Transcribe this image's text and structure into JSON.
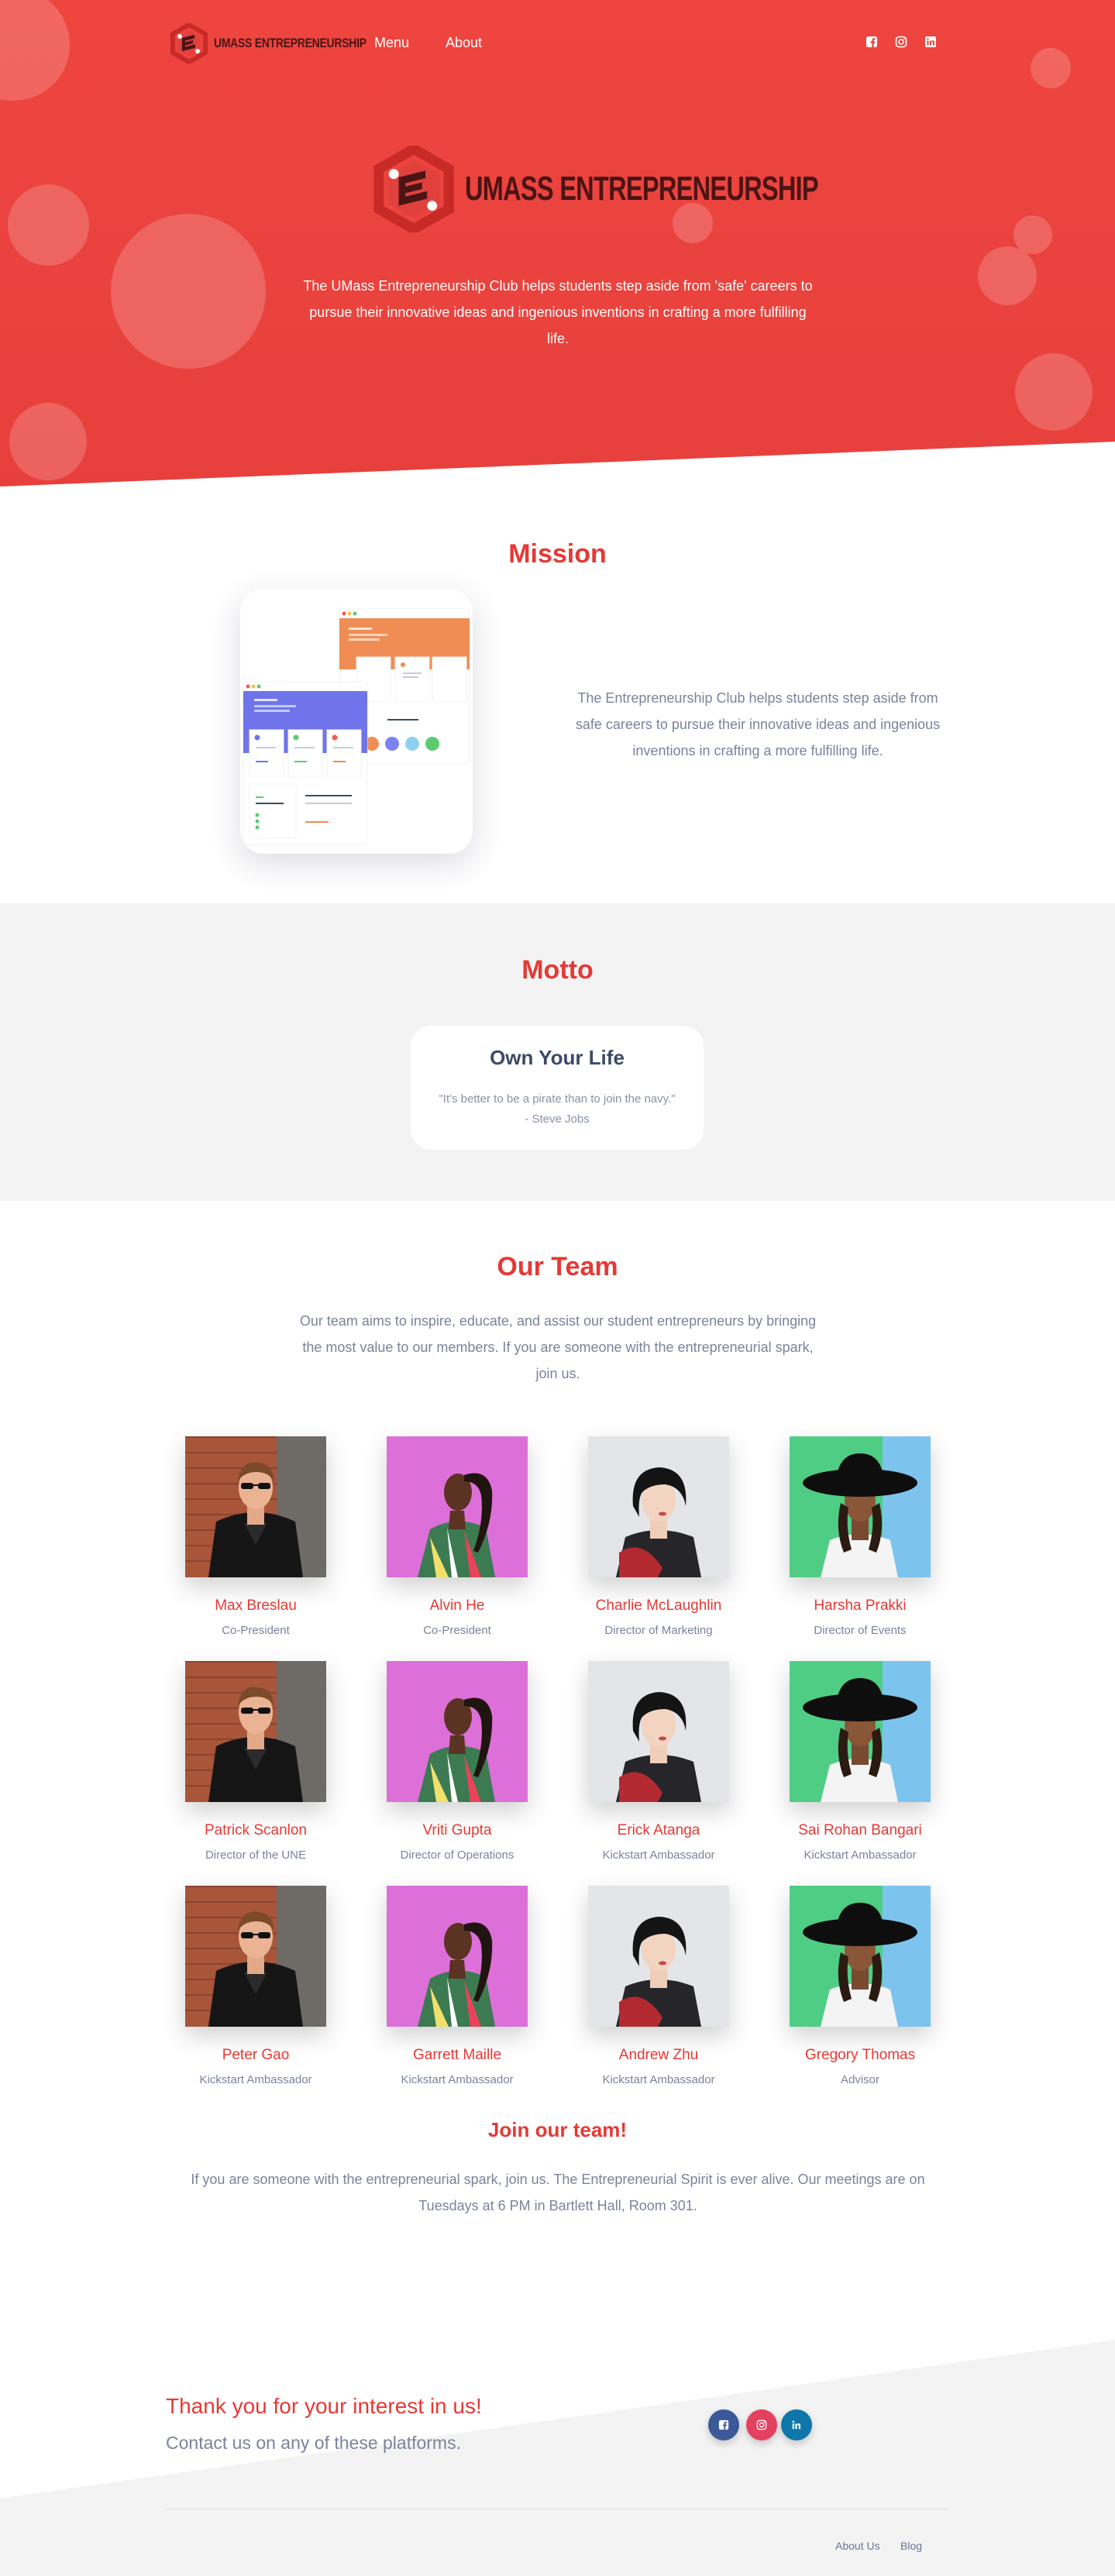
{
  "nav": {
    "brand": "UMass Entrepreneurship",
    "menu_label": "Menu",
    "about_label": "About",
    "social_icons": [
      "facebook-icon",
      "instagram-icon",
      "linkedin-icon"
    ]
  },
  "hero": {
    "brand": "UMass Entrepreneurship",
    "description": "The UMass Entrepreneurship Club helps students step aside from 'safe' careers to pursue their innovative ideas and ingenious inventions in crafting a more fulfilling life."
  },
  "mission": {
    "title": "Mission",
    "text": "The Entrepreneurship Club helps students step aside from safe careers to pursue their innovative ideas and ingenious inventions in crafting a more fulfilling life."
  },
  "motto": {
    "title": "Motto",
    "heading": "Own Your Life",
    "quote": "\"It's better to be a pirate than to join the navy.\"",
    "author": "- Steve Jobs"
  },
  "team": {
    "title": "Our Team",
    "intro": "Our team aims to inspire, educate, and assist our student entrepreneurs by bringing the most value to our members. If you are someone with the entrepreneurial spark, join us.",
    "members": [
      {
        "name": "Max Breslau",
        "role": "Co-President",
        "photo": "man-leather-jacket"
      },
      {
        "name": "Alvin He",
        "role": "Co-President",
        "photo": "woman-pink-background"
      },
      {
        "name": "Charlie McLaughlin",
        "role": "Director of Marketing",
        "photo": "woman-black-bob"
      },
      {
        "name": "Harsha Prakki",
        "role": "Director of Events",
        "photo": "woman-black-hat"
      },
      {
        "name": "Patrick Scanlon",
        "role": "Director of the UNE",
        "photo": "man-leather-jacket"
      },
      {
        "name": "Vriti Gupta",
        "role": "Director of Operations",
        "photo": "woman-pink-background"
      },
      {
        "name": "Erick Atanga",
        "role": "Kickstart Ambassador",
        "photo": "woman-black-bob"
      },
      {
        "name": "Sai Rohan Bangari",
        "role": "Kickstart Ambassador",
        "photo": "woman-black-hat"
      },
      {
        "name": "Peter Gao",
        "role": "Kickstart Ambassador",
        "photo": "man-leather-jacket"
      },
      {
        "name": "Garrett Maille",
        "role": "Kickstart Ambassador",
        "photo": "woman-pink-background"
      },
      {
        "name": "Andrew Zhu",
        "role": "Kickstart Ambassador",
        "photo": "woman-black-bob"
      },
      {
        "name": "Gregory Thomas",
        "role": "Advisor",
        "photo": "woman-black-hat"
      }
    ],
    "join_title": "Join our team!",
    "join_text": "If you are someone with the entrepreneurial spark, join us. The Entrepreneurial Spirit is ever alive. Our meetings are on Tuesdays at 6 PM in Bartlett Hall, Room 301."
  },
  "footer": {
    "thanks": "Thank you for your interest in us!",
    "contact": "Contact us on any of these platforms.",
    "social_buttons": [
      "facebook-icon",
      "instagram-icon",
      "linkedin-icon"
    ],
    "links": [
      "About Us",
      "Blog"
    ]
  },
  "colors": {
    "brand_red": "#e53935",
    "hero_red": "#ee453f",
    "text_muted": "#7a839c",
    "facebook": "#3b5998",
    "instagram": "#e4405f",
    "linkedin": "#0e76a8"
  }
}
